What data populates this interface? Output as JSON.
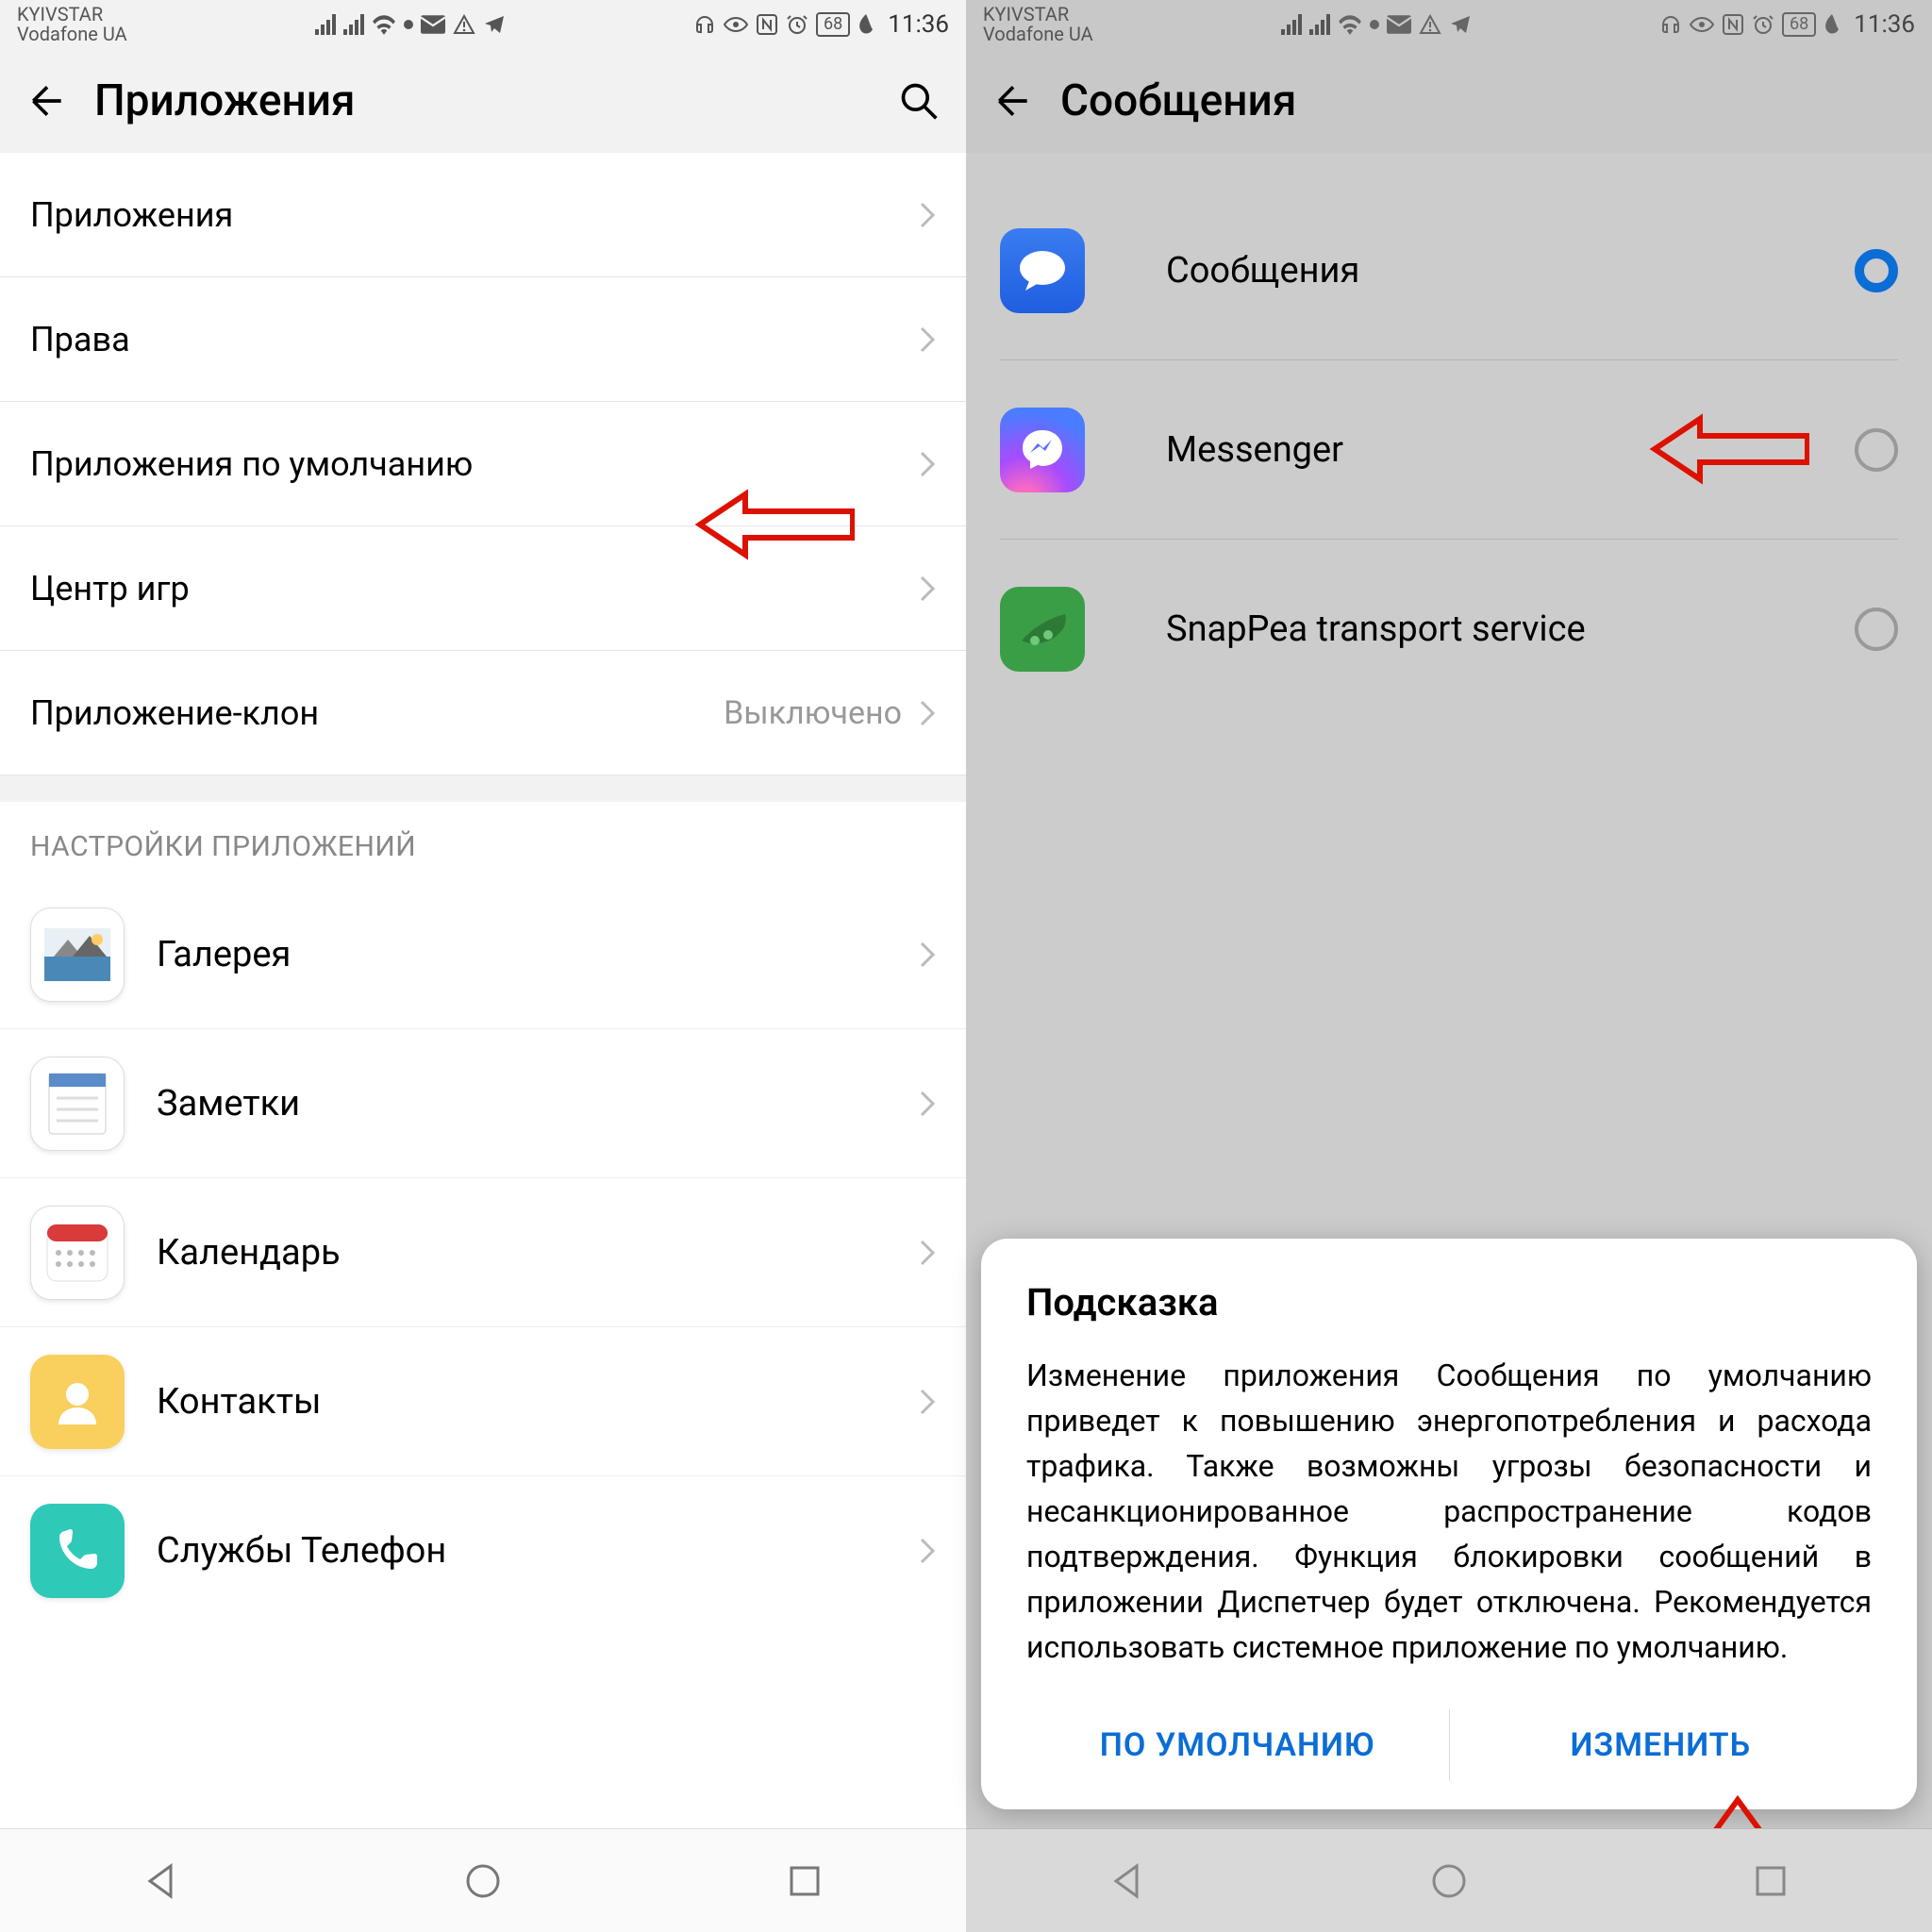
{
  "status": {
    "carrier1": "KYIVSTAR",
    "carrier2": "Vodafone UA",
    "battery": "68",
    "time": "11:36"
  },
  "left": {
    "title": "Приложения",
    "rows": [
      {
        "label": "Приложения"
      },
      {
        "label": "Права"
      },
      {
        "label": "Приложения по умолчанию"
      },
      {
        "label": "Центр игр"
      },
      {
        "label": "Приложение-клон",
        "value": "Выключено"
      }
    ],
    "section": "НАСТРОЙКИ ПРИЛОЖЕНИЙ",
    "apps": [
      {
        "label": "Галерея",
        "icon": "gallery"
      },
      {
        "label": "Заметки",
        "icon": "notes"
      },
      {
        "label": "Календарь",
        "icon": "calendar"
      },
      {
        "label": "Контакты",
        "icon": "contacts"
      },
      {
        "label": "Службы Телефон",
        "icon": "phone"
      }
    ]
  },
  "right": {
    "title": "Сообщения",
    "options": [
      {
        "label": "Сообщения",
        "icon": "messages",
        "selected": true
      },
      {
        "label": "Messenger",
        "icon": "messenger",
        "selected": false
      },
      {
        "label": "SnapPea transport service",
        "icon": "snappea",
        "selected": false
      }
    ],
    "dialog": {
      "title": "Подсказка",
      "body": "Изменение приложения Сообщения по умолчанию приведет к повышению энергопотребления и расхода трафика. Также возможны угрозы безопасности и несанкционированное распространение кодов подтверждения. Функция блокировки сообщений в приложении Диспетчер будет отключена. Рекомендуется использовать системное приложение по умолчанию.",
      "default_btn": "ПО УМОЛЧАНИЮ",
      "change_btn": "ИЗМЕНИТЬ"
    }
  }
}
